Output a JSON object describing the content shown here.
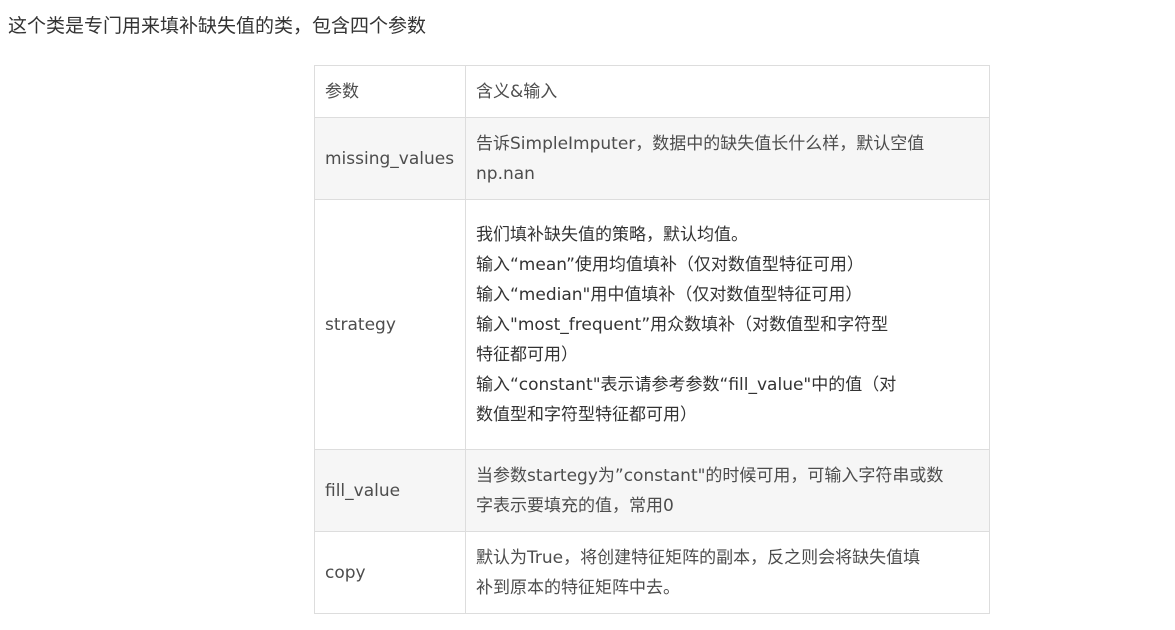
{
  "intro": "这个类是专门用来填补缺失值的类，包含四个参数",
  "table": {
    "header": {
      "param": "参数",
      "meaning": "含义&输入"
    },
    "rows": [
      {
        "param": "missing_values",
        "lines": [
          "告诉SimpleImputer，数据中的缺失值长什么样，默认空值",
          "np.nan"
        ]
      },
      {
        "param": "strategy",
        "lines": [
          "我们填补缺失值的策略，默认均值。",
          "输入“mean”使用均值填补（仅对数值型特征可用）",
          "输入“median\"用中值填补（仅对数值型特征可用）",
          "输入\"most_frequent”用众数填补（对数值型和字符型",
          "特征都可用）",
          "输入“constant\"表示请参考参数“fill_value\"中的值（对",
          "数值型和字符型特征都可用）"
        ]
      },
      {
        "param": "fill_value",
        "lines": [
          "当参数startegy为”constant\"的时候可用，可输入字符串或数",
          "字表示要填充的值，常用0"
        ]
      },
      {
        "param": "copy",
        "lines": [
          "默认为True，将创建特征矩阵的副本，反之则会将缺失值填",
          "补到原本的特征矩阵中去。"
        ]
      }
    ]
  }
}
